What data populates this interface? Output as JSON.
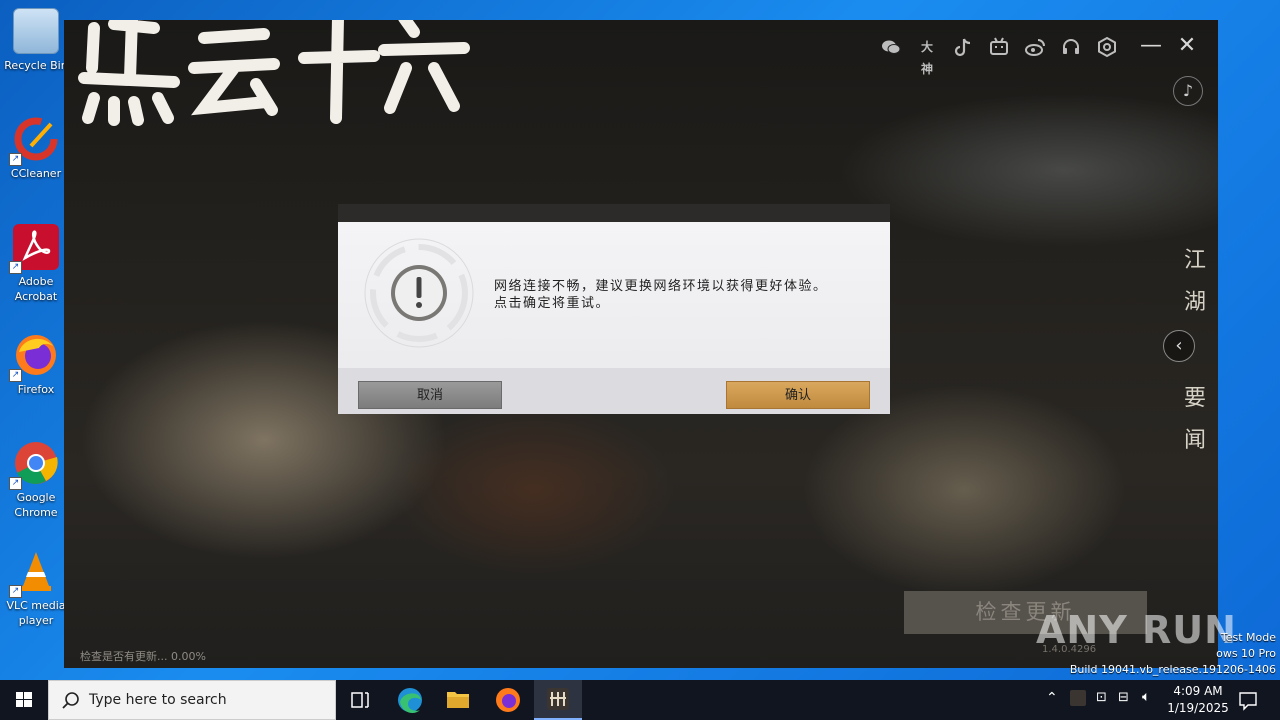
{
  "desktop": {
    "icons": [
      {
        "label": "Recycle Bin"
      },
      {
        "label": "CCleaner"
      },
      {
        "label": "Adobe Acrobat"
      },
      {
        "label": "Firefox"
      },
      {
        "label": "Google Chrome"
      },
      {
        "label": "VLC media player"
      }
    ]
  },
  "launcher": {
    "top_icons": [
      "wechat-icon",
      "dashen-icon",
      "tiktok-icon",
      "bilibili-icon",
      "weibo-icon",
      "headset-icon",
      "settings-icon"
    ],
    "dashen_label": "大神",
    "news_panel": {
      "chars": [
        "江",
        "湖",
        "要",
        "闻"
      ]
    },
    "check_update_label": "检查更新",
    "status_text": "检查是否有更新... 0.00%",
    "version_text": "1.4.0.4296"
  },
  "dialog": {
    "message_line1": "网络连接不畅，建议更换网络环境以获得更好体验。",
    "message_line2": "点击确定将重试。",
    "cancel_label": "取消",
    "confirm_label": "确认"
  },
  "watermark": {
    "text": "ANY RUN",
    "test_mode_line1": "Test Mode",
    "test_mode_line2": "ows 10 Pro",
    "test_mode_line3": "Build 19041.vb_release.191206-1406"
  },
  "taskbar": {
    "search_placeholder": "Type here to search",
    "time": "4:09 AM",
    "date": "1/19/2025"
  },
  "colors": {
    "accent_confirm": "#c99448",
    "desktop_bg": "#0b6fd4",
    "taskbar": "#101520"
  }
}
